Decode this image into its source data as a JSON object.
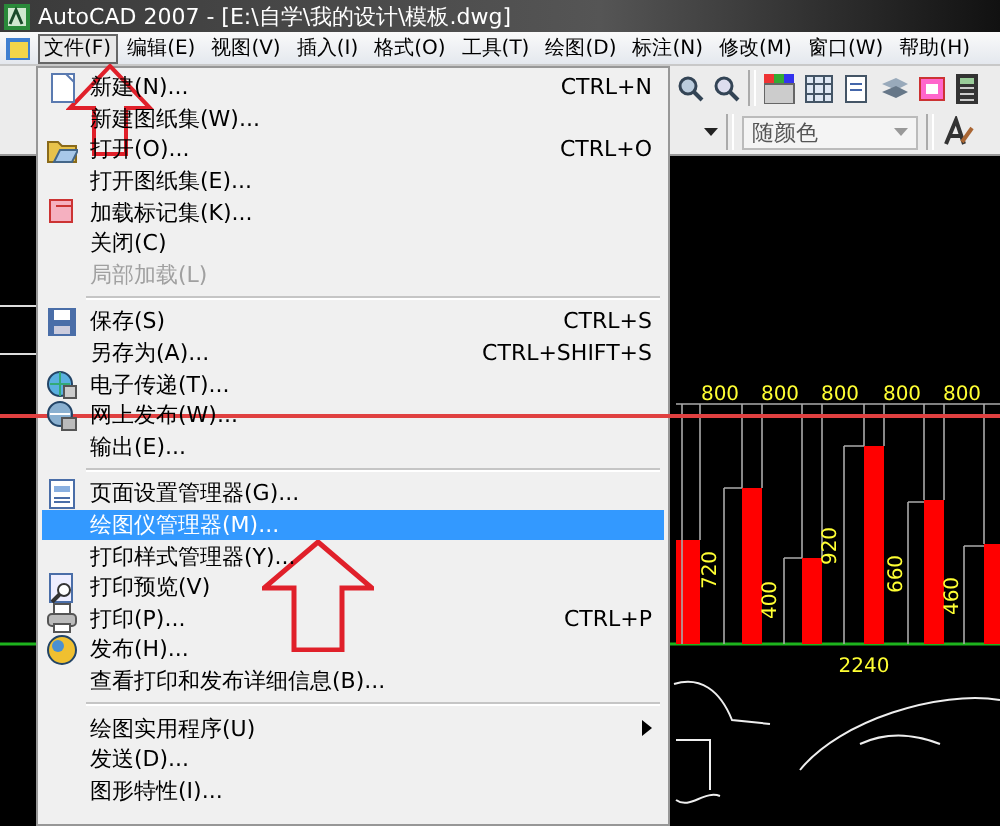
{
  "window": {
    "title": "AutoCAD 2007 - [E:\\自学\\我的设计\\模板.dwg]"
  },
  "menubar": [
    {
      "label": "文件(F)",
      "selected": true
    },
    {
      "label": "编辑(E)",
      "selected": false
    },
    {
      "label": "视图(V)",
      "selected": false
    },
    {
      "label": "插入(I)",
      "selected": false
    },
    {
      "label": "格式(O)",
      "selected": false
    },
    {
      "label": "工具(T)",
      "selected": false
    },
    {
      "label": "绘图(D)",
      "selected": false
    },
    {
      "label": "标注(N)",
      "selected": false
    },
    {
      "label": "修改(M)",
      "selected": false
    },
    {
      "label": "窗口(W)",
      "selected": false
    },
    {
      "label": "帮助(H)",
      "selected": false
    }
  ],
  "toolbar": {
    "color_dropdown": "随颜色"
  },
  "file_menu": {
    "groups": [
      [
        {
          "label": "新建(N)...",
          "shortcut": "CTRL+N",
          "icon": true,
          "disabled": false,
          "selected": false,
          "submenu": false
        },
        {
          "label": "新建图纸集(W)...",
          "icon": false,
          "disabled": false,
          "selected": false,
          "submenu": false
        },
        {
          "label": "打开(O)...",
          "shortcut": "CTRL+O",
          "icon": true,
          "disabled": false,
          "selected": false,
          "submenu": false
        },
        {
          "label": "打开图纸集(E)...",
          "icon": false,
          "disabled": false,
          "selected": false,
          "submenu": false
        },
        {
          "label": "加载标记集(K)...",
          "icon": true,
          "disabled": false,
          "selected": false,
          "submenu": false
        },
        {
          "label": "关闭(C)",
          "icon": false,
          "disabled": false,
          "selected": false,
          "submenu": false
        },
        {
          "label": "局部加载(L)",
          "icon": false,
          "disabled": true,
          "selected": false,
          "submenu": false
        }
      ],
      [
        {
          "label": "保存(S)",
          "shortcut": "CTRL+S",
          "icon": true,
          "disabled": false,
          "selected": false,
          "submenu": false
        },
        {
          "label": "另存为(A)...",
          "shortcut": "CTRL+SHIFT+S",
          "icon": false,
          "disabled": false,
          "selected": false,
          "submenu": false
        },
        {
          "label": "电子传递(T)...",
          "icon": true,
          "disabled": false,
          "selected": false,
          "submenu": false
        },
        {
          "label": "网上发布(W)...",
          "icon": true,
          "disabled": false,
          "selected": false,
          "submenu": false
        },
        {
          "label": "输出(E)...",
          "icon": false,
          "disabled": false,
          "selected": false,
          "submenu": false
        }
      ],
      [
        {
          "label": "页面设置管理器(G)...",
          "icon": true,
          "disabled": false,
          "selected": false,
          "submenu": false
        },
        {
          "label": "绘图仪管理器(M)...",
          "icon": false,
          "disabled": false,
          "selected": true,
          "submenu": false
        },
        {
          "label": "打印样式管理器(Y)...",
          "icon": false,
          "disabled": false,
          "selected": false,
          "submenu": false
        },
        {
          "label": "打印预览(V)",
          "icon": true,
          "disabled": false,
          "selected": false,
          "submenu": false
        },
        {
          "label": "打印(P)...",
          "shortcut": "CTRL+P",
          "icon": true,
          "disabled": false,
          "selected": false,
          "submenu": false
        },
        {
          "label": "发布(H)...",
          "icon": true,
          "disabled": false,
          "selected": false,
          "submenu": false
        },
        {
          "label": "查看打印和发布详细信息(B)...",
          "icon": false,
          "disabled": false,
          "selected": false,
          "submenu": false
        }
      ],
      [
        {
          "label": "绘图实用程序(U)",
          "icon": false,
          "disabled": false,
          "selected": false,
          "submenu": true
        },
        {
          "label": "发送(D)...",
          "icon": false,
          "disabled": false,
          "selected": false,
          "submenu": false
        },
        {
          "label": "图形特性(I)...",
          "icon": false,
          "disabled": false,
          "selected": false,
          "submenu": false
        }
      ]
    ]
  },
  "drawing": {
    "top_dimensions": [
      "800",
      "800",
      "800",
      "800",
      "800"
    ],
    "bar_dimensions": [
      "720",
      "400",
      "920",
      "660",
      "460"
    ],
    "total_dimension": "2240"
  }
}
